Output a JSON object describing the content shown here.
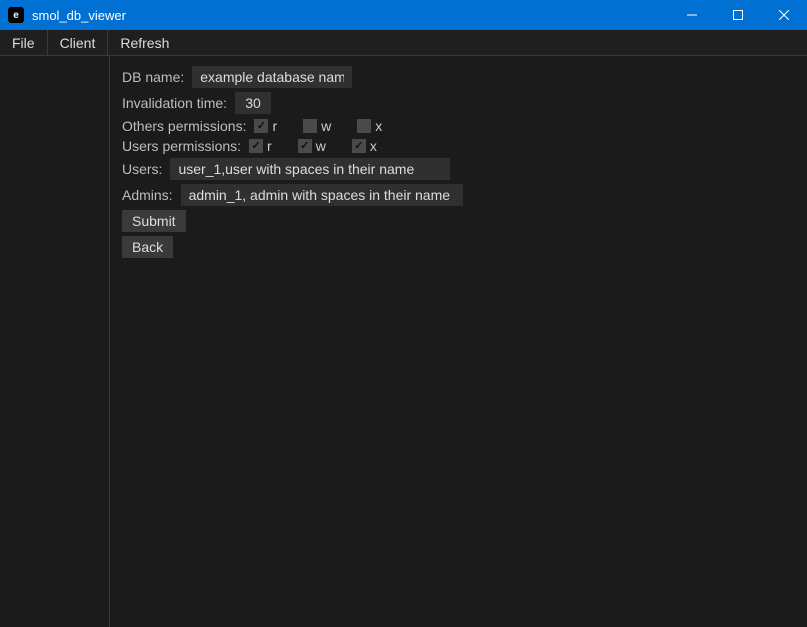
{
  "window": {
    "app_icon_letter": "e",
    "title": "smol_db_viewer"
  },
  "menubar": {
    "file": "File",
    "client": "Client",
    "refresh": "Refresh"
  },
  "form": {
    "db_name_label": "DB name:",
    "db_name_value": "example database name",
    "invalidation_label": "Invalidation time:",
    "invalidation_value": "30",
    "others_perm_label": "Others permissions:",
    "users_perm_label": "Users permissions:",
    "perm_r": "r",
    "perm_w": "w",
    "perm_x": "x",
    "users_label": "Users:",
    "users_value": "user_1,user with spaces in their name",
    "admins_label": "Admins:",
    "admins_value": "admin_1, admin with spaces in their name",
    "submit": "Submit",
    "back": "Back"
  },
  "permissions": {
    "others": {
      "r": true,
      "w": false,
      "x": false
    },
    "users": {
      "r": true,
      "w": true,
      "x": true
    }
  }
}
